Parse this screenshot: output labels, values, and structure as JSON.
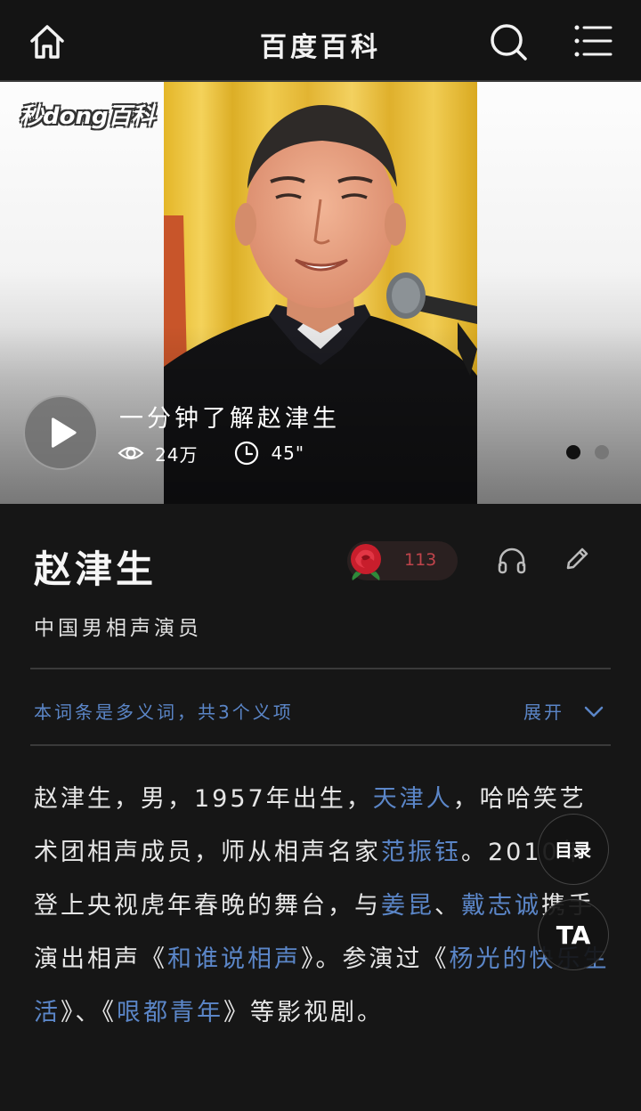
{
  "header": {
    "title": "百度百科",
    "icons": [
      "home-icon",
      "search-icon",
      "menu-icon"
    ]
  },
  "video": {
    "logo_text": "秒dong百科",
    "title": "一分钟了解赵津生",
    "views": "24万",
    "duration": "45\"",
    "slide_count": 2,
    "active_slide": 1
  },
  "entry": {
    "name": "赵津生",
    "like_count": "113",
    "subtitle": "中国男相声演员",
    "polysemy_notice": "本词条是多义词，共3个义项",
    "expand_label": "展开"
  },
  "summary": {
    "t1": "赵津生，男，1957年出生，",
    "l1": "天津人",
    "t2": "，哈哈笑艺术团相声成员，师从相声名家",
    "l2": "范振钰",
    "t3": "。2010年登上央视虎年春晚的舞台，与",
    "l3": "姜昆",
    "t4": "、",
    "l4": "戴志诚",
    "t5": "携手演出相声《",
    "l5": "和谁说相声",
    "t6": "》。参演过《",
    "l6": "杨光的快乐生活",
    "t7": "》、《",
    "l7": "哏都青年",
    "t8": "》等影视剧。"
  },
  "floating": {
    "toc_label": "目录",
    "ta_label": "TA"
  },
  "colors": {
    "background": "#161616",
    "link": "#5b86c8",
    "like_count": "#c0444b"
  }
}
